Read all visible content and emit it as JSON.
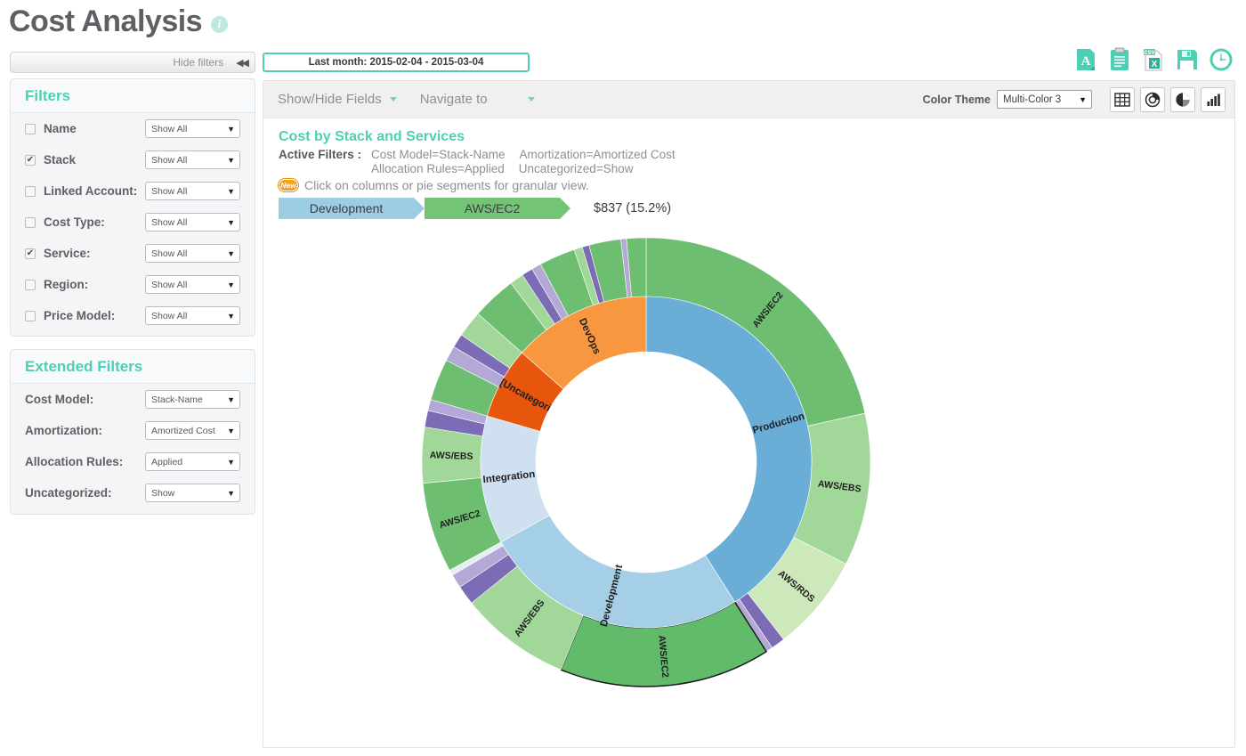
{
  "page": {
    "title": "Cost Analysis",
    "info_icon": "info-icon"
  },
  "sidebar": {
    "hide_filters_label": "Hide filters",
    "collapse_glyph": "◀◀",
    "filters": {
      "heading": "Filters",
      "rows": [
        {
          "label": "Name",
          "checked": false,
          "value": "Show All"
        },
        {
          "label": "Stack",
          "checked": true,
          "value": "Show All"
        },
        {
          "label": "Linked Account:",
          "checked": false,
          "value": "Show All"
        },
        {
          "label": "Cost Type:",
          "checked": false,
          "value": "Show All"
        },
        {
          "label": "Service:",
          "checked": true,
          "value": "Show All"
        },
        {
          "label": "Region:",
          "checked": false,
          "value": "Show All"
        },
        {
          "label": "Price Model:",
          "checked": false,
          "value": "Show All"
        }
      ]
    },
    "extended_filters": {
      "heading": "Extended Filters",
      "rows": [
        {
          "label": "Cost Model:",
          "value": "Stack-Name"
        },
        {
          "label": "Amortization:",
          "value": "Amortized Cost"
        },
        {
          "label": "Allocation Rules:",
          "value": "Applied"
        },
        {
          "label": "Uncategorized:",
          "value": "Show"
        }
      ]
    }
  },
  "date_range": {
    "label": "Last month:  2015-02-04 - 2015-03-04"
  },
  "export_bar": {
    "icons": [
      "pdf-export-icon",
      "clipboard-report-icon",
      "csv-export-icon",
      "save-icon",
      "schedule-clock-icon"
    ]
  },
  "toolbar": {
    "show_hide_fields": "Show/Hide Fields",
    "navigate_to": "Navigate to",
    "color_theme_label": "Color Theme",
    "color_theme_value": "Multi-Color 3",
    "viz_buttons": [
      "table-view-icon",
      "bubble-chart-icon",
      "pie-chart-icon",
      "bar-chart-icon"
    ]
  },
  "chart_header": {
    "title": "Cost by Stack and Services",
    "active_filters_key": "Active Filters :",
    "active_filters_line1": [
      "Cost Model=Stack-Name",
      "Amortization=Amortized Cost"
    ],
    "active_filters_line2": [
      "Allocation Rules=Applied",
      "Uncategorized=Show"
    ],
    "new_badge": "New",
    "hint": "Click on columns or pie segments for granular view.",
    "crumb1": "Development",
    "crumb2": "AWS/EC2",
    "crumb_value": "$837 (15.2%)"
  },
  "chart_data": {
    "type": "pie",
    "title": "Cost by Stack and Services",
    "subtype": "sunburst-donut",
    "legend": "none",
    "selected_path": [
      "Development",
      "AWS/EC2"
    ],
    "selected_value": "$837 (15.2%)",
    "selected_percent": 15.2,
    "inner_ring": {
      "name": "Stack",
      "categories": [
        "Production",
        "Development",
        "Integration",
        "[Uncategorized]",
        "DevOps"
      ],
      "values": [
        41.0,
        26.0,
        12.5,
        7.0,
        13.5
      ],
      "colors": [
        "#6aaed8",
        "#a4cfe6",
        "#cfe0f0",
        "#e8550d",
        "#f79841"
      ]
    },
    "outer_ring": {
      "name": "Service",
      "segments": [
        {
          "parent": "Production",
          "label": "AWS/EC2",
          "value": 21.5,
          "color": "#6ebe72"
        },
        {
          "parent": "Production",
          "label": "AWS/EBS",
          "value": 11.0,
          "color": "#a2d79a"
        },
        {
          "parent": "Production",
          "label": "AWS/RDS",
          "value": 7.0,
          "color": "#cde9bb"
        },
        {
          "parent": "Production",
          "label": "",
          "value": 1.0,
          "color": "#7b6cb5"
        },
        {
          "parent": "Production",
          "label": "",
          "value": 0.5,
          "color": "#b3a8d6"
        },
        {
          "parent": "Development",
          "label": "AWS/EC2",
          "value": 15.2,
          "color": "#61bb6a",
          "selected": true
        },
        {
          "parent": "Development",
          "label": "AWS/EBS",
          "value": 8.0,
          "color": "#a2d79a"
        },
        {
          "parent": "Development",
          "label": "",
          "value": 1.4,
          "color": "#7b6cb5"
        },
        {
          "parent": "Development",
          "label": "",
          "value": 1.0,
          "color": "#b3a8d6"
        },
        {
          "parent": "Development",
          "label": "",
          "value": 0.4,
          "color": "#e4eff4"
        },
        {
          "parent": "Integration",
          "label": "AWS/EC2",
          "value": 6.5,
          "color": "#6ebe72"
        },
        {
          "parent": "Integration",
          "label": "AWS/EBS",
          "value": 4.0,
          "color": "#a2d79a"
        },
        {
          "parent": "Integration",
          "label": "",
          "value": 1.2,
          "color": "#7b6cb5"
        },
        {
          "parent": "Integration",
          "label": "",
          "value": 0.8,
          "color": "#b3a8d6"
        },
        {
          "parent": "[Uncategorized]",
          "label": "",
          "value": 3.0,
          "color": "#6ebe72"
        },
        {
          "parent": "[Uncategorized]",
          "label": "",
          "value": 1.1,
          "color": "#b3a8d6"
        },
        {
          "parent": "[Uncategorized]",
          "label": "",
          "value": 1.0,
          "color": "#7b6cb5"
        },
        {
          "parent": "[Uncategorized]",
          "label": "",
          "value": 1.9,
          "color": "#a2d79a"
        },
        {
          "parent": "DevOps",
          "label": "",
          "value": 3.2,
          "color": "#6ebe72"
        },
        {
          "parent": "DevOps",
          "label": "",
          "value": 1.0,
          "color": "#a2d79a"
        },
        {
          "parent": "DevOps",
          "label": "",
          "value": 0.8,
          "color": "#7b6cb5"
        },
        {
          "parent": "DevOps",
          "label": "",
          "value": 0.7,
          "color": "#b3a8d6"
        },
        {
          "parent": "DevOps",
          "label": "",
          "value": 2.6,
          "color": "#6ebe72"
        },
        {
          "parent": "DevOps",
          "label": "",
          "value": 0.6,
          "color": "#a2d79a"
        },
        {
          "parent": "DevOps",
          "label": "",
          "value": 0.5,
          "color": "#7b6cb5"
        },
        {
          "parent": "DevOps",
          "label": "",
          "value": 2.3,
          "color": "#6ebe72"
        },
        {
          "parent": "DevOps",
          "label": "",
          "value": 0.4,
          "color": "#b3a8d6"
        },
        {
          "parent": "DevOps",
          "label": "",
          "value": 1.4,
          "color": "#6ebe72"
        }
      ]
    },
    "colors": {
      "accent_teal": "#4ccfb4",
      "crumb_stack": "#9dcde4",
      "crumb_service": "#73c575",
      "badge_orange": "#f7a11a"
    }
  }
}
